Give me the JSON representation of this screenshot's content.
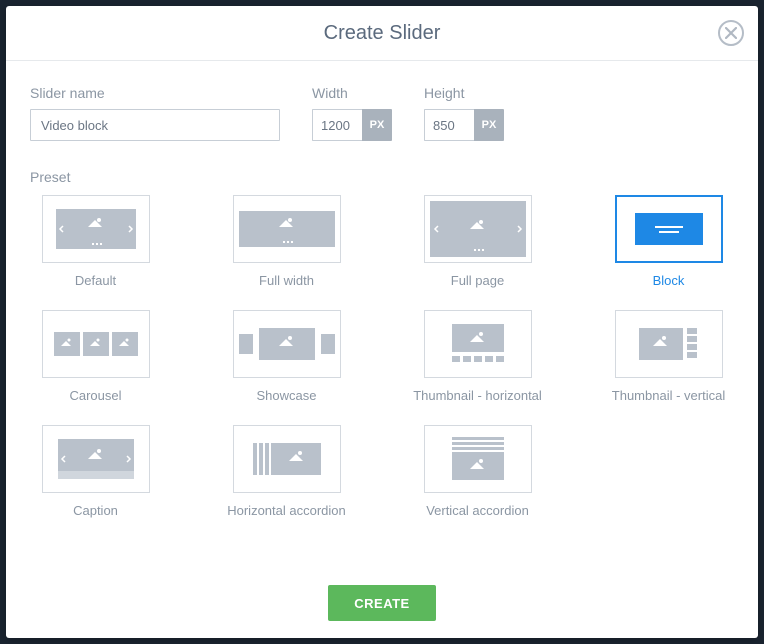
{
  "title": "Create Slider",
  "labels": {
    "slider_name": "Slider name",
    "width": "Width",
    "height": "Height",
    "preset": "Preset",
    "unit": "PX"
  },
  "form": {
    "slider_name": "Video block",
    "width": "1200",
    "height": "850"
  },
  "presets": [
    {
      "id": "default",
      "label": "Default",
      "selected": false
    },
    {
      "id": "full-width",
      "label": "Full width",
      "selected": false
    },
    {
      "id": "full-page",
      "label": "Full page",
      "selected": false
    },
    {
      "id": "block",
      "label": "Block",
      "selected": true
    },
    {
      "id": "carousel",
      "label": "Carousel",
      "selected": false
    },
    {
      "id": "showcase",
      "label": "Showcase",
      "selected": false
    },
    {
      "id": "thumb-horizontal",
      "label": "Thumbnail - horizontal",
      "selected": false
    },
    {
      "id": "thumb-vertical",
      "label": "Thumbnail - vertical",
      "selected": false
    },
    {
      "id": "caption",
      "label": "Caption",
      "selected": false
    },
    {
      "id": "h-accordion",
      "label": "Horizontal accordion",
      "selected": false
    },
    {
      "id": "v-accordion",
      "label": "Vertical accordion",
      "selected": false
    }
  ],
  "buttons": {
    "create": "CREATE"
  }
}
